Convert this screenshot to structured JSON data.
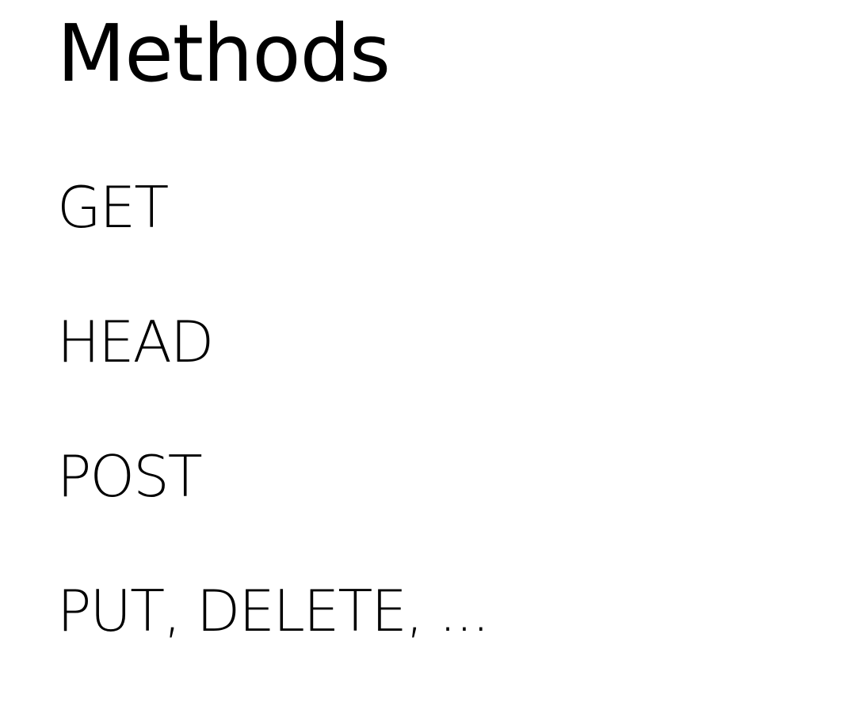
{
  "slide": {
    "title": "Methods",
    "items": [
      "GET",
      "HEAD",
      "POST",
      "PUT, DELETE, ..."
    ]
  }
}
